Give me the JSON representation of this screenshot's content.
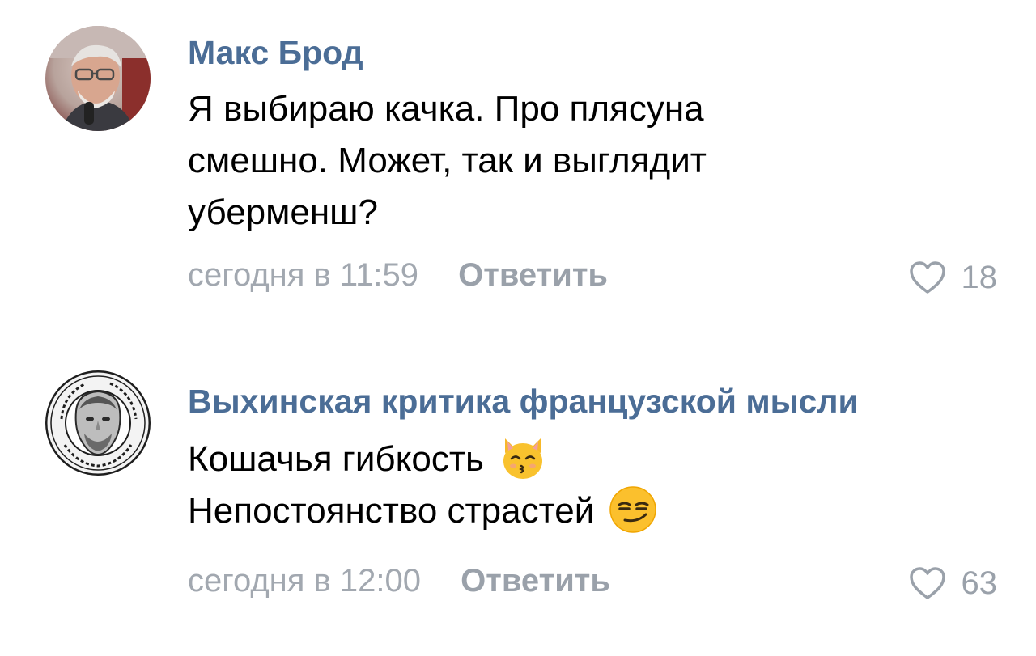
{
  "colors": {
    "author_link": "#4b6d96",
    "text": "#000000",
    "meta": "#a2a8b0"
  },
  "comments": [
    {
      "author": "Макс Брод",
      "avatar": "avatar-photo-man-with-glasses",
      "lines": [
        "Я выбираю качка. Про плясуна",
        "смешно. Может, так и выглядит",
        "уберменш?"
      ],
      "time": "сегодня в 11:59",
      "reply_label": "Ответить",
      "likes": "18"
    },
    {
      "author": "Выхинская критика французской мысли",
      "avatar": "round-seal-logo-with-philosopher-bust",
      "lines": [
        "Кошачья гибкость",
        "Непостоянство страстей"
      ],
      "emojis": [
        "kissing-cat-emoji",
        "smirking-face-emoji"
      ],
      "time": "сегодня в 12:00",
      "reply_label": "Ответить",
      "likes": "63"
    }
  ]
}
